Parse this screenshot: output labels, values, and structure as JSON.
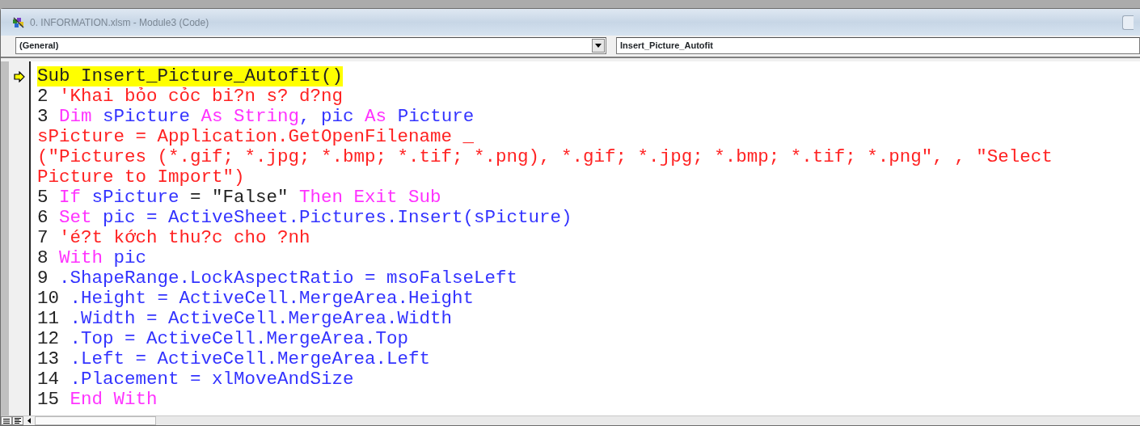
{
  "window": {
    "title": "0. INFORMATION.xlsm - Module3 (Code)"
  },
  "object_dropdown": {
    "value": "(General)"
  },
  "procedure_dropdown": {
    "value": "Insert_Picture_Autofit"
  },
  "code_lines": [
    {
      "current": true,
      "tokens": [
        {
          "kind": "plain",
          "text": "Sub Insert_Picture_Autofit()"
        }
      ]
    },
    {
      "current": false,
      "tokens": [
        {
          "kind": "plain",
          "text": "2 "
        },
        {
          "kind": "red",
          "text": "'Khai bỏo cỏc bi?n s? d?ng"
        }
      ]
    },
    {
      "current": false,
      "tokens": [
        {
          "kind": "plain",
          "text": "3 "
        },
        {
          "kind": "keyword",
          "text": "Dim "
        },
        {
          "kind": "ident",
          "text": "sPicture "
        },
        {
          "kind": "keyword",
          "text": "As String"
        },
        {
          "kind": "ident",
          "text": ", pic "
        },
        {
          "kind": "keyword",
          "text": "As "
        },
        {
          "kind": "ident",
          "text": "Picture"
        }
      ]
    },
    {
      "current": false,
      "tokens": [
        {
          "kind": "red",
          "text": "sPicture = Application.GetOpenFilename _"
        }
      ]
    },
    {
      "current": false,
      "tokens": [
        {
          "kind": "red",
          "text": "(\"Pictures (*.gif; *.jpg; *.bmp; *.tif; *.png), *.gif; *.jpg; *.bmp; *.tif; *.png\", , \"Select"
        }
      ]
    },
    {
      "current": false,
      "tokens": [
        {
          "kind": "red",
          "text": "Picture to Import\")"
        }
      ]
    },
    {
      "current": false,
      "tokens": [
        {
          "kind": "plain",
          "text": "5 "
        },
        {
          "kind": "keyword",
          "text": "If "
        },
        {
          "kind": "ident",
          "text": "sPicture "
        },
        {
          "kind": "plain",
          "text": "= \"False\" "
        },
        {
          "kind": "keyword",
          "text": "Then Exit Sub"
        }
      ]
    },
    {
      "current": false,
      "tokens": [
        {
          "kind": "plain",
          "text": "6 "
        },
        {
          "kind": "keyword",
          "text": "Set "
        },
        {
          "kind": "ident",
          "text": "pic = ActiveSheet.Pictures.Insert(sPicture)"
        }
      ]
    },
    {
      "current": false,
      "tokens": [
        {
          "kind": "plain",
          "text": "7 "
        },
        {
          "kind": "red",
          "text": "'é?t kớch thu?c cho ?nh"
        }
      ]
    },
    {
      "current": false,
      "tokens": [
        {
          "kind": "plain",
          "text": "8 "
        },
        {
          "kind": "keyword",
          "text": "With "
        },
        {
          "kind": "ident",
          "text": "pic"
        }
      ]
    },
    {
      "current": false,
      "tokens": [
        {
          "kind": "plain",
          "text": "9 "
        },
        {
          "kind": "ident",
          "text": ".ShapeRange.LockAspectRatio = msoFalseLeft"
        }
      ]
    },
    {
      "current": false,
      "tokens": [
        {
          "kind": "plain",
          "text": "10 "
        },
        {
          "kind": "ident",
          "text": ".Height = ActiveCell.MergeArea.Height"
        }
      ]
    },
    {
      "current": false,
      "tokens": [
        {
          "kind": "plain",
          "text": "11 "
        },
        {
          "kind": "ident",
          "text": ".Width = ActiveCell.MergeArea.Width"
        }
      ]
    },
    {
      "current": false,
      "tokens": [
        {
          "kind": "plain",
          "text": "12 "
        },
        {
          "kind": "ident",
          "text": ".Top = ActiveCell.MergeArea.Top"
        }
      ]
    },
    {
      "current": false,
      "tokens": [
        {
          "kind": "plain",
          "text": "13 "
        },
        {
          "kind": "ident",
          "text": ".Left = ActiveCell.MergeArea.Left"
        }
      ]
    },
    {
      "current": false,
      "tokens": [
        {
          "kind": "plain",
          "text": "14 "
        },
        {
          "kind": "ident",
          "text": ".Placement = xlMoveAndSize"
        }
      ]
    },
    {
      "current": false,
      "tokens": [
        {
          "kind": "plain",
          "text": "15 "
        },
        {
          "kind": "keyword",
          "text": "End With"
        }
      ]
    }
  ]
}
